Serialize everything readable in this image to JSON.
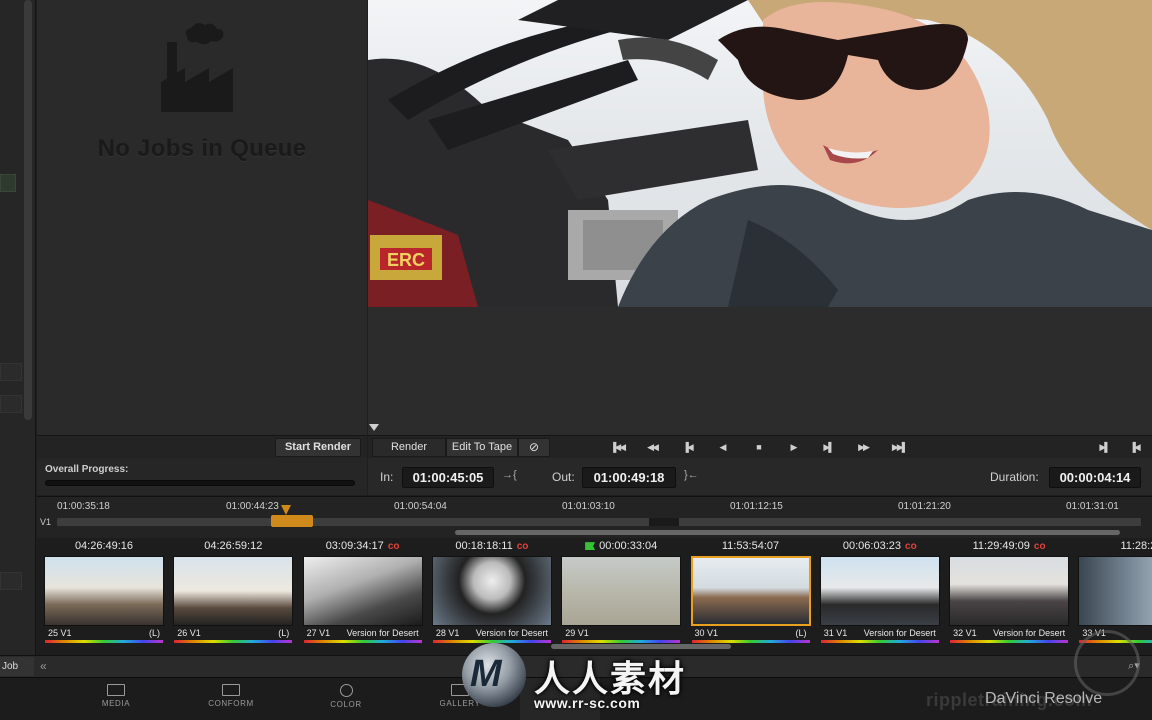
{
  "queue": {
    "empty_message": "No Jobs in Queue",
    "start_render": "Start Render",
    "progress_label": "Overall Progress:",
    "progress": 0.0
  },
  "viewer": {
    "tabs": {
      "render": "Render",
      "edit_to_tape": "Edit To Tape"
    },
    "in_label": "In:",
    "in_tc": "01:00:45:05",
    "out_label": "Out:",
    "out_tc": "01:00:49:18",
    "duration_label": "Duration:",
    "duration_tc": "00:00:04:14"
  },
  "ruler": {
    "track": "V1",
    "labels": [
      "01:00:35:18",
      "01:00:44:23",
      "01:00:54:04",
      "01:01:03:10",
      "01:01:12:15",
      "01:01:21:20",
      "01:01:31:01"
    ]
  },
  "clips": [
    {
      "tc": "04:26:49:16",
      "num": "25 V1",
      "label": "(L)",
      "link": false,
      "flag": false
    },
    {
      "tc": "04:26:59:12",
      "num": "26 V1",
      "label": "(L)",
      "link": false,
      "flag": false
    },
    {
      "tc": "03:09:34:17",
      "num": "27 V1",
      "label": "Version for Desert",
      "link": true,
      "flag": false
    },
    {
      "tc": "00:18:18:11",
      "num": "28 V1",
      "label": "Version for Desert",
      "link": true,
      "flag": false
    },
    {
      "tc": "00:00:33:04",
      "num": "29 V1",
      "label": "",
      "link": false,
      "flag": true
    },
    {
      "tc": "11:53:54:07",
      "num": "30 V1",
      "label": "(L)",
      "link": false,
      "flag": false,
      "selected": true
    },
    {
      "tc": "00:06:03:23",
      "num": "31 V1",
      "label": "Version for Desert",
      "link": true,
      "flag": false
    },
    {
      "tc": "11:29:49:09",
      "num": "32 V1",
      "label": "Version for Desert",
      "link": true,
      "flag": false
    },
    {
      "tc": "11:28:2",
      "num": "33 V1",
      "label": "",
      "link": false,
      "flag": false
    }
  ],
  "bottom": {
    "job": "Job"
  },
  "pages": [
    {
      "label": "MEDIA",
      "icon": "media-icon"
    },
    {
      "label": "CONFORM",
      "icon": "conform-icon"
    },
    {
      "label": "COLOR",
      "icon": "color-icon"
    },
    {
      "label": "GALLERY",
      "icon": "gallery-icon"
    }
  ],
  "watermark": {
    "cn": "人人素材",
    "url": "www.rr-sc.com",
    "ripple": "rippletraining.com",
    "product": "DaVinci Resolve"
  },
  "colors": {
    "accent": "#d08a1c",
    "link_red": "#e0433a",
    "flag_green": "#35c235",
    "selected_border": "#e8a020"
  }
}
